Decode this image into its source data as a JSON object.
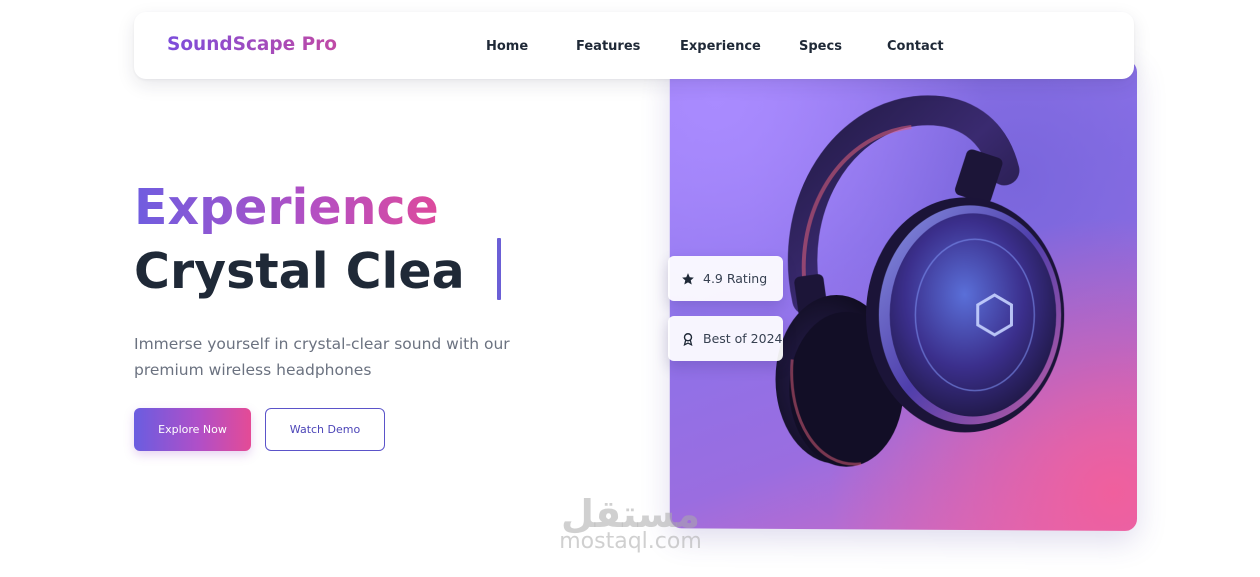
{
  "nav": {
    "brand": "SoundScape Pro",
    "links": [
      {
        "label": "Home"
      },
      {
        "label": "Features"
      },
      {
        "label": "Experience"
      },
      {
        "label": "Specs"
      },
      {
        "label": "Contact"
      }
    ]
  },
  "hero": {
    "title_line1": "Experience",
    "title_line2": "Crystal Clea",
    "subtitle": "Immerse yourself in crystal-clear sound with our premium wireless headphones",
    "primary_button": "Explore Now",
    "secondary_button": "Watch Demo"
  },
  "badges": {
    "rating": {
      "label": "4.9 Rating",
      "icon": "star-icon"
    },
    "award": {
      "label": "Best of 2024",
      "icon": "award-icon"
    }
  },
  "watermark": {
    "arabic": "مستقل",
    "latin": "mostaql.com"
  },
  "colors": {
    "brand_gradient_start": "#7c4ddb",
    "brand_gradient_end": "#c04aa5",
    "accent_purple": "#6b5fd6",
    "accent_pink": "#e44b96",
    "heading_dark": "#1f2937",
    "body_gray": "#6b7280"
  }
}
